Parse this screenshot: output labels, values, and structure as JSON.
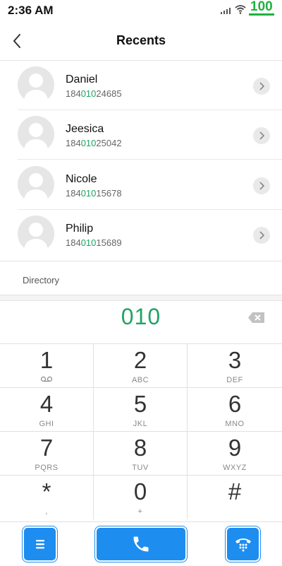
{
  "status_bar": {
    "time": "2:36 AM",
    "battery": "100"
  },
  "header": {
    "title": "Recents"
  },
  "contacts": [
    {
      "name": "Daniel",
      "number_prefix": "184",
      "number_match": "010",
      "number_suffix": "24685"
    },
    {
      "name": "Jeesica",
      "number_prefix": "184",
      "number_match": "010",
      "number_suffix": "25042"
    },
    {
      "name": "Nicole",
      "number_prefix": "184",
      "number_match": "010",
      "number_suffix": "15678"
    },
    {
      "name": "Philip",
      "number_prefix": "184",
      "number_match": "010",
      "number_suffix": "15689"
    }
  ],
  "directory": {
    "label": "Directory"
  },
  "dialer": {
    "entered_digits": "010"
  },
  "keys": [
    {
      "digit": "1",
      "sub": ""
    },
    {
      "digit": "2",
      "sub": "ABC"
    },
    {
      "digit": "3",
      "sub": "DEF"
    },
    {
      "digit": "4",
      "sub": "GHI"
    },
    {
      "digit": "5",
      "sub": "JKL"
    },
    {
      "digit": "6",
      "sub": "MNO"
    },
    {
      "digit": "7",
      "sub": "PQRS"
    },
    {
      "digit": "8",
      "sub": "TUV"
    },
    {
      "digit": "9",
      "sub": "WXYZ"
    },
    {
      "digit": "*",
      "sub": ","
    },
    {
      "digit": "0",
      "sub": "+"
    },
    {
      "digit": "#",
      "sub": ""
    }
  ],
  "colors": {
    "accent_blue": "#1e8df0",
    "match_green": "#21a365",
    "battery_green": "#1fb140"
  },
  "icons": {
    "back": "chevron-left-icon",
    "row_action": "chevron-right-icon",
    "backspace": "backspace-icon",
    "voicemail": "voicemail-icon",
    "menu": "menu-icon",
    "call": "phone-icon",
    "dialpad": "dialpad-phone-icon"
  }
}
